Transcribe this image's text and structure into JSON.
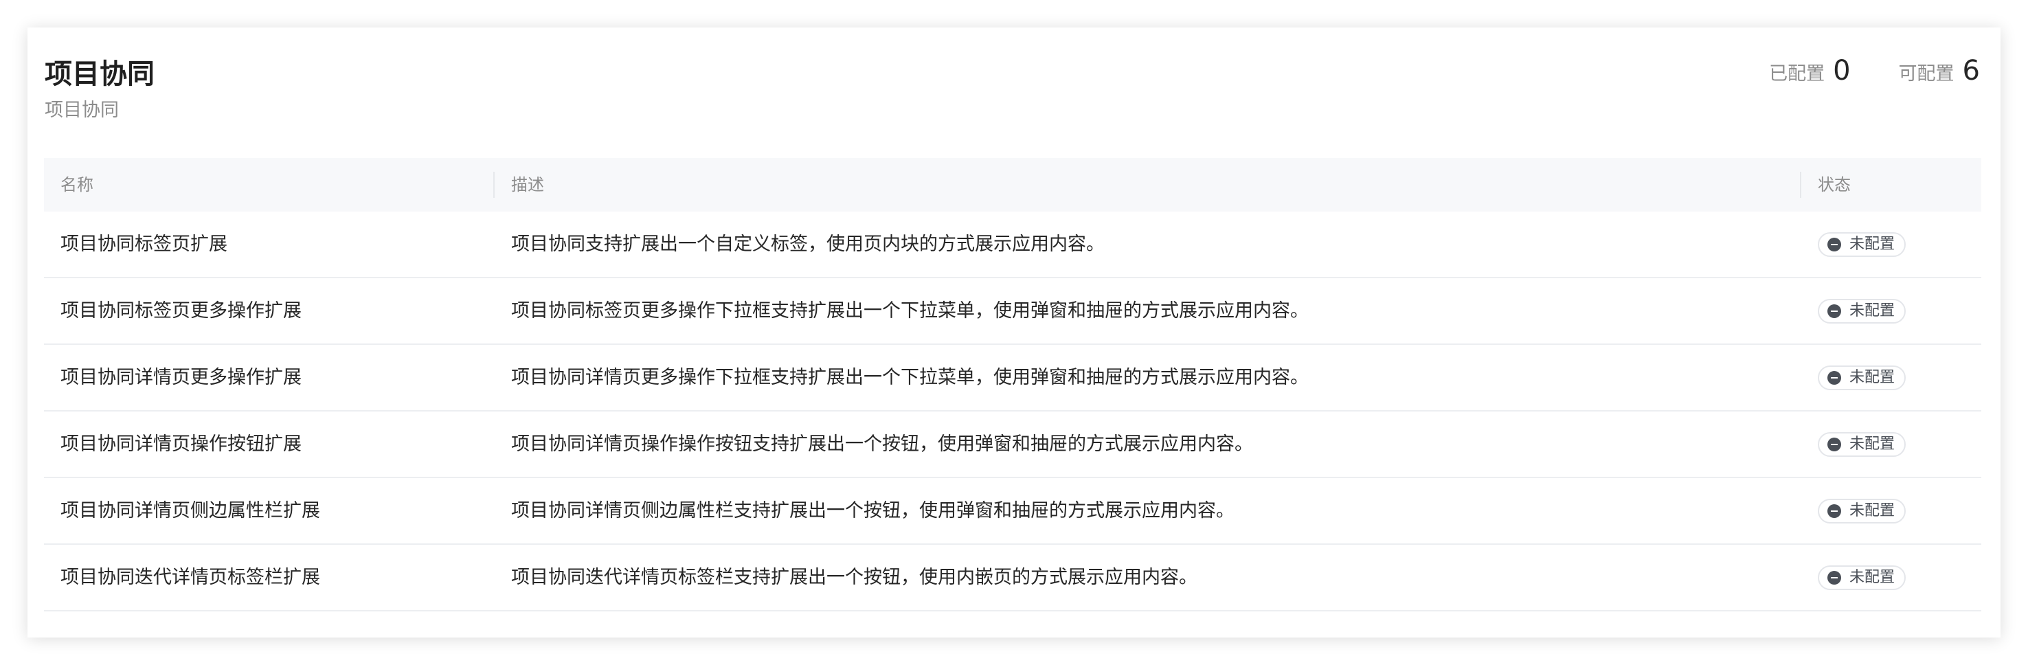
{
  "header": {
    "title": "项目协同",
    "subtitle": "项目协同"
  },
  "stats": {
    "configured_label": "已配置",
    "configured_value": "0",
    "configurable_label": "可配置",
    "configurable_value": "6"
  },
  "table": {
    "columns": [
      "名称",
      "描述",
      "状态"
    ],
    "rows": [
      {
        "name": "项目协同标签页扩展",
        "description": "项目协同支持扩展出一个自定义标签，使用页内块的方式展示应用内容。",
        "status": "未配置"
      },
      {
        "name": "项目协同标签页更多操作扩展",
        "description": "项目协同标签页更多操作下拉框支持扩展出一个下拉菜单，使用弹窗和抽屉的方式展示应用内容。",
        "status": "未配置"
      },
      {
        "name": "项目协同详情页更多操作扩展",
        "description": "项目协同详情页更多操作下拉框支持扩展出一个下拉菜单，使用弹窗和抽屉的方式展示应用内容。",
        "status": "未配置"
      },
      {
        "name": "项目协同详情页操作按钮扩展",
        "description": "项目协同详情页操作操作按钮支持扩展出一个按钮，使用弹窗和抽屉的方式展示应用内容。",
        "status": "未配置"
      },
      {
        "name": "项目协同详情页侧边属性栏扩展",
        "description": "项目协同详情页侧边属性栏支持扩展出一个按钮，使用弹窗和抽屉的方式展示应用内容。",
        "status": "未配置"
      },
      {
        "name": "项目协同迭代详情页标签栏扩展",
        "description": "项目协同迭代详情页标签栏支持扩展出一个按钮，使用内嵌页的方式展示应用内容。",
        "status": "未配置"
      }
    ]
  },
  "icons": {
    "status": "minus-circle-icon"
  }
}
